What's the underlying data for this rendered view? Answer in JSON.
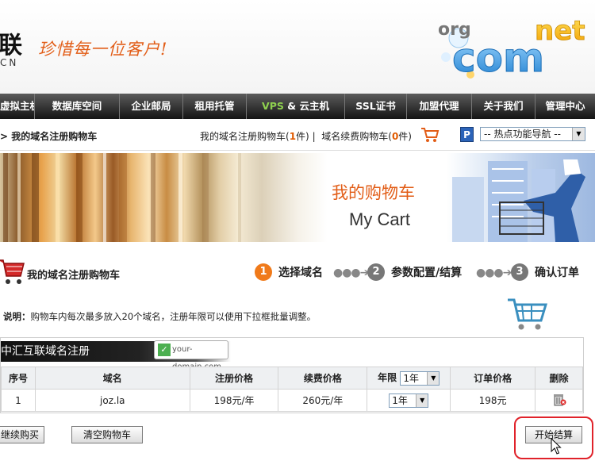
{
  "header": {
    "logo_char": "联",
    "logo_sub": "CN",
    "slogan": "珍惜每一位客户!",
    "domain_logo": {
      "org": "org",
      "com": "com",
      "net": "net"
    }
  },
  "nav": {
    "items": [
      {
        "label": "虚拟主机"
      },
      {
        "label": "数据库空间"
      },
      {
        "label": "企业邮局"
      },
      {
        "label": "租用托管"
      },
      {
        "label_hl": "VPS",
        "label": " & 云主机"
      },
      {
        "label": "SSL证书"
      },
      {
        "label": "加盟代理"
      },
      {
        "label": "关于我们"
      },
      {
        "label": "管理中心"
      }
    ]
  },
  "breadcrumb": {
    "text": "> 我的域名注册购物车"
  },
  "cart_links": {
    "reg_prefix": "我的域名注册购物车(",
    "reg_count": "1",
    "reg_suffix": "件)",
    "sep": "|",
    "renew_prefix": "域名续费购物车(",
    "renew_count": "0",
    "renew_suffix": "件)"
  },
  "hot_nav": {
    "p_label": "P",
    "selected": "-- 热点功能导航 --"
  },
  "banner": {
    "title": "我的购物车",
    "subtitle": "My Cart"
  },
  "steps": {
    "title": "我的域名注册购物车",
    "items": [
      {
        "num": "1",
        "label": "选择域名"
      },
      {
        "num": "2",
        "label": "参数配置/结算"
      },
      {
        "num": "3",
        "label": "确认订单"
      }
    ],
    "arrow": "●●●➔"
  },
  "note": {
    "label": "说明：",
    "text": "购物车内每次最多放入20个域名，注册年限可以使用下拉框批量调整。"
  },
  "table": {
    "header_title": "中汇互联域名注册",
    "badge": "your-domain.com",
    "columns": [
      "序号",
      "域名",
      "注册价格",
      "续费价格",
      "年限",
      "订单价格",
      "删除"
    ],
    "year_all": "1年",
    "rows": [
      {
        "index": "1",
        "domain": "joz.la",
        "reg_price": "198元/年",
        "renew_price": "260元/年",
        "years": "1年",
        "order_price": "198元"
      }
    ]
  },
  "buttons": {
    "continue": "继续购买",
    "clear": "清空购物车",
    "checkout": "开始结算"
  },
  "colors": {
    "accent": "#e25d17",
    "step_active": "#f07a1a",
    "highlight_ring": "#e0222a",
    "nav_dark": "#141414"
  }
}
